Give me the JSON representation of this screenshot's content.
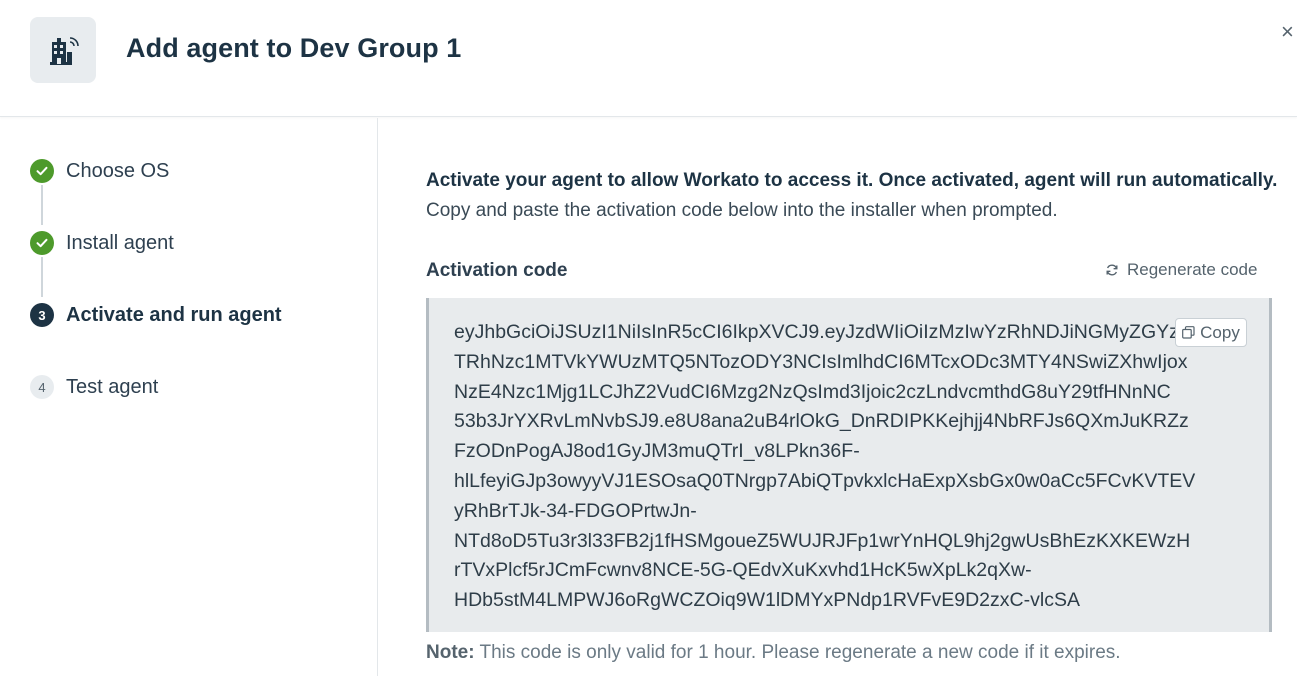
{
  "header": {
    "title": "Add agent to Dev Group 1",
    "icon": "building-signal-icon",
    "close_icon": "close-icon",
    "close_glyph": "×"
  },
  "steps": [
    {
      "label": "Choose OS",
      "state": "done",
      "marker": ""
    },
    {
      "label": "Install agent",
      "state": "done",
      "marker": ""
    },
    {
      "label": "Activate and run agent",
      "state": "current",
      "marker": "3"
    },
    {
      "label": "Test agent",
      "state": "todo",
      "marker": "4"
    }
  ],
  "main": {
    "intro_bold": "Activate your agent to allow Workato to access it. Once activated, agent will run automatically.",
    "intro_text": "Copy and paste the activation code below into the installer when prompted.",
    "code_label": "Activation code",
    "regenerate_label": "Regenerate code",
    "copy_label": "Copy",
    "code_lines": [
      "eyJhbGciOiJSUzI1NiIsInR5cCI6IkpXVCJ9.eyJzdWIiOiIzMzIwYzRhNDJiNGMyZGYzM",
      "TRhNzc1MTVkYWUzMTQ5NTozODY3NCIsImlhdCI6MTcxODc3MTY4NSwiZXhwIjox",
      "NzE4Nzc1Mjg1LCJhZ2VudCI6Mzg2NzQsImd3Ijoic2czLndvcmthdG8uY29tfHNnNC",
      "53b3JrYXRvLmNvbSJ9.e8U8ana2uB4rlOkG_DnRDIPKKejhjj4NbRFJs6QXmJuKRZz",
      "FzODnPogAJ8od1GyJM3muQTrI_v8LPkn36F-",
      "hlLfeyiGJp3owyyVJ1ESOsaQ0TNrgp7AbiQTpvkxlcHaExpXsbGx0w0aCc5FCvKVTEV",
      "yRhBrTJk-34-FDGOPrtwJn-",
      "NTd8oD5Tu3r3l33FB2j1fHSMgoueZ5WUJRJFp1wrYnHQL9hj2gwUsBhEzKXKEWzH",
      "rTVxPlcf5rJCmFcwnv8NCE-5G-QEdvXuKxvhd1HcK5wXpLk2qXw-",
      "HDb5stM4LMPWJ6oRgWCZOiq9W1lDMYxPNdp1RVFvE9D2zxC-vlcSA"
    ],
    "note_label": "Note:",
    "note_text": " This code is only valid for 1 hour. Please regenerate a new code if it expires."
  },
  "colors": {
    "done": "#4d9a2b",
    "current": "#1d3344",
    "code_bg": "#e8ebed"
  }
}
